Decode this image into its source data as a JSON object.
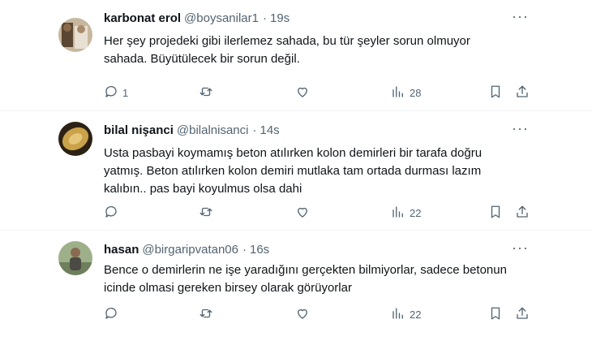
{
  "tweets": [
    {
      "name": "karbonat erol",
      "handle": "@boysanilar1",
      "dot": "·",
      "time": "19s",
      "lines": [
        "Her şey projedeki gibi ilerlemez sahada, bu tür şeyler sorun olmuyor",
        "sahada. Büyütülecek bir sorun değil."
      ],
      "replies": "1",
      "retweets": "",
      "likes": "",
      "views": "28",
      "avatar_colors": {
        "bg": "#b8a48a",
        "fg": "#4a3a2a"
      }
    },
    {
      "name": "bilal nişanci",
      "handle": "@bilalnisanci",
      "dot": "·",
      "time": "14s",
      "lines": [
        "Usta pasbayi koymamış beton atılırken kolon demirleri bir tarafa doğru",
        "yatmış. Beton atılırken kolon demiri mutlaka tam ortada durması lazım",
        "kalıbın.. pas bayi koyulmus olsa dahi"
      ],
      "replies": "",
      "retweets": "",
      "likes": "",
      "views": "22",
      "avatar_colors": {
        "bg": "#c9a24a",
        "fg": "#3b2a12"
      }
    },
    {
      "name": "hasan",
      "handle": "@birgaripvatan06",
      "dot": "·",
      "time": "16s",
      "lines": [
        "Bence o demirlerin ne işe yaradığını gerçekten bilmiyorlar, sadece betonun",
        "icinde olmasi gereken birsey olarak görüyorlar"
      ],
      "replies": "",
      "retweets": "",
      "likes": "",
      "views": "22",
      "avatar_colors": {
        "bg": "#8aa07a",
        "fg": "#2f3a28"
      }
    }
  ],
  "icons": {
    "more": "more-icon",
    "reply": "reply-icon",
    "retweet": "retweet-icon",
    "like": "like-icon",
    "views": "views-icon",
    "bookmark": "bookmark-icon",
    "share": "share-icon"
  },
  "more_glyph": "···"
}
